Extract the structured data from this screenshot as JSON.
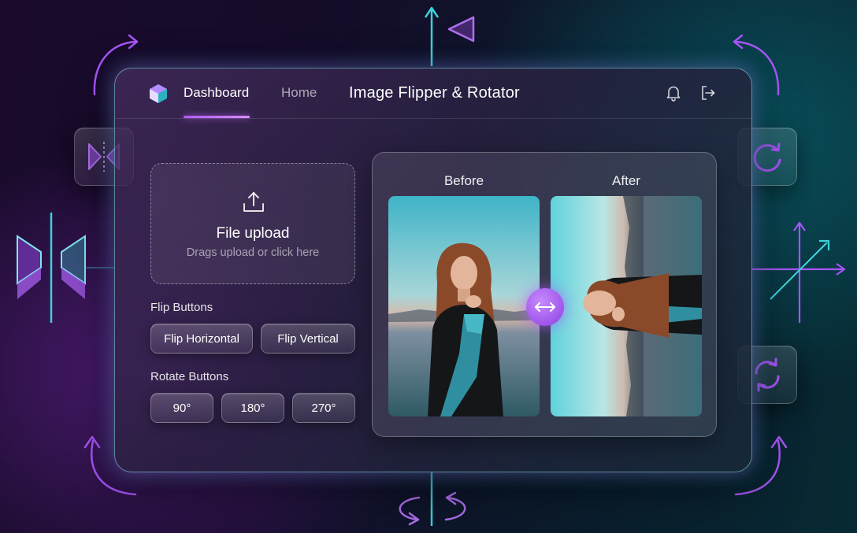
{
  "nav": {
    "dashboard_label": "Dashboard",
    "home_label": "Home",
    "active": "Dashboard"
  },
  "app": {
    "title": "Image Flipper & Rotator"
  },
  "header_icons": [
    "bell-icon",
    "logout-icon"
  ],
  "upload": {
    "title": "File upload",
    "subtitle": "Drags upload or click here",
    "icon": "upload-icon"
  },
  "flip": {
    "label": "Flip Buttons",
    "horizontal_label": "Flip Horizontal",
    "vertical_label": "Flip Vertical"
  },
  "rotate": {
    "label": "Rotate Buttons",
    "options": [
      "90°",
      "180°",
      "270°"
    ]
  },
  "preview": {
    "before_label": "Before",
    "after_label": "After",
    "swap_icon": "swap-arrows-icon"
  },
  "colors": {
    "accent_purple": "#a855f7",
    "accent_teal": "#38d6d6",
    "window_border": "#8cdce6"
  }
}
